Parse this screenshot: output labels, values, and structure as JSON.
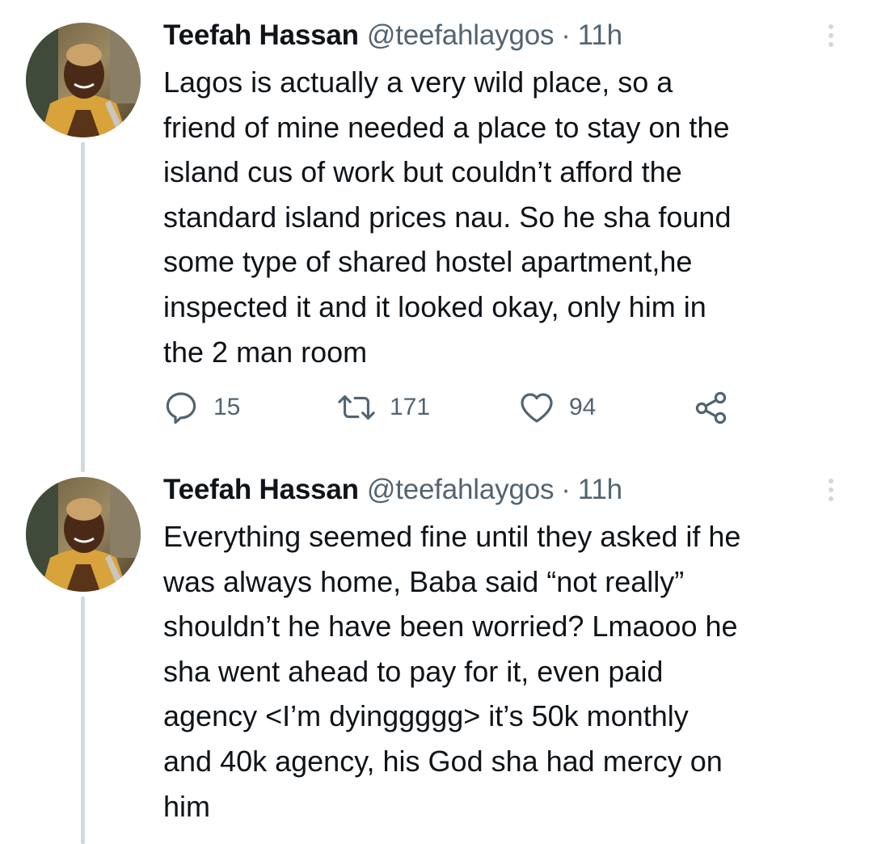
{
  "tweets": [
    {
      "author_name": "Teefah Hassan",
      "handle": "@teefahlaygos",
      "separator": "·",
      "time": "11h",
      "text_lines": [
        "Lagos is actually a very wild place, so a",
        "friend of mine needed a place to stay on the",
        "island cus of work but couldn’t afford the",
        "standard island prices nau. So he sha found",
        "some type of shared hostel apartment,he",
        "inspected it and it looked okay, only him in",
        "the 2 man room"
      ],
      "replies": "15",
      "retweets": "171",
      "likes": "94"
    },
    {
      "author_name": "Teefah Hassan",
      "handle": "@teefahlaygos",
      "separator": "·",
      "time": "11h",
      "text_lines": [
        "Everything seemed fine until they asked if he",
        "was always home, Baba said “not really”",
        "shouldn’t he have been worried? Lmaooo he",
        "sha went ahead to pay for it, even paid",
        "agency <I’m dyinggggg> it’s 50k monthly",
        "and 40k agency, his God sha had mercy on",
        "him"
      ]
    }
  ],
  "icons": {
    "reply": "reply-icon",
    "retweet": "retweet-icon",
    "like": "heart-icon",
    "share": "share-icon",
    "more": "more-options-icon"
  },
  "colors": {
    "text": "#0f1419",
    "secondary": "#536471",
    "thread_line": "#cfd9de"
  }
}
